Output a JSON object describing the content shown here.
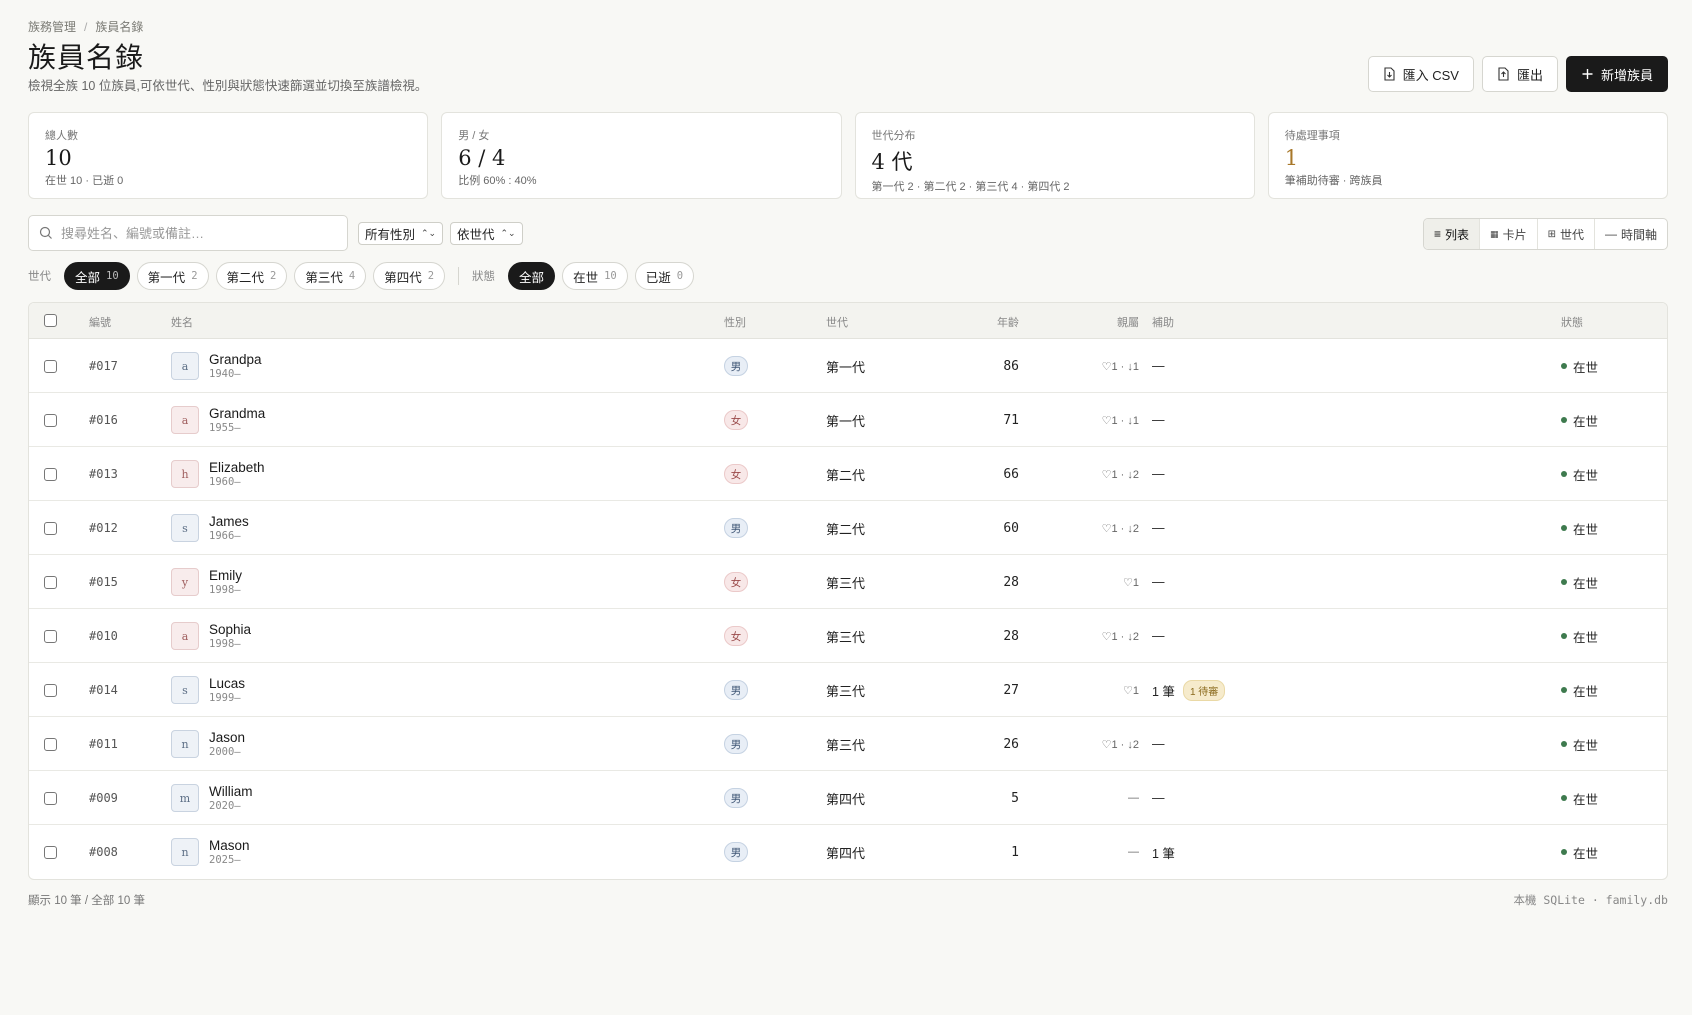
{
  "breadcrumb": {
    "parent": "族務管理",
    "sep": "/",
    "current": "族員名錄"
  },
  "title": "族員名錄",
  "description": "檢視全族 10 位族員,可依世代、性別與狀態快速篩選並切換至族譜檢視。",
  "actions": {
    "import": "匯入 CSV",
    "export": "匯出",
    "add": "新增族員"
  },
  "stats": [
    {
      "label": "總人數",
      "value": "10",
      "sub": "在世 10 · 已逝 0"
    },
    {
      "label": "男 / 女",
      "value": "6 / 4",
      "sub": "比例 60% : 40%"
    },
    {
      "label": "世代分布",
      "value": "4 代",
      "sub": "第一代 2 · 第二代 2 · 第三代 4 · 第四代 2"
    },
    {
      "label": "待處理事項",
      "value": "1",
      "sub": "筆補助待審 · 跨族員"
    }
  ],
  "search": {
    "placeholder": "搜尋姓名、編號或備註…"
  },
  "filters": {
    "gender": "所有性別",
    "sort": "依世代"
  },
  "views": {
    "list": "列表",
    "card": "卡片",
    "gen": "世代",
    "timeline": "時間軸"
  },
  "chips": {
    "gen_label": "世代",
    "gen": [
      {
        "label": "全部",
        "count": "10"
      },
      {
        "label": "第一代",
        "count": "2"
      },
      {
        "label": "第二代",
        "count": "2"
      },
      {
        "label": "第三代",
        "count": "4"
      },
      {
        "label": "第四代",
        "count": "2"
      }
    ],
    "status_label": "狀態",
    "status": [
      {
        "label": "全部",
        "count": ""
      },
      {
        "label": "在世",
        "count": "10"
      },
      {
        "label": "已逝",
        "count": "0"
      }
    ]
  },
  "columns": {
    "id": "編號",
    "name": "姓名",
    "gender": "性別",
    "gen": "世代",
    "age": "年齡",
    "rel": "親屬",
    "aid": "補助",
    "status": "狀態"
  },
  "rows": [
    {
      "id": "#017",
      "initial": "a",
      "name": "Grandpa",
      "years": "1940–",
      "gender": "男",
      "gen": "第一代",
      "age": "86",
      "rel": "♡1 · ↓1",
      "aid": "—",
      "pending": "",
      "status": "在世"
    },
    {
      "id": "#016",
      "initial": "a",
      "name": "Grandma",
      "years": "1955–",
      "gender": "女",
      "gen": "第一代",
      "age": "71",
      "rel": "♡1 · ↓1",
      "aid": "—",
      "pending": "",
      "status": "在世"
    },
    {
      "id": "#013",
      "initial": "h",
      "name": "Elizabeth",
      "years": "1960–",
      "gender": "女",
      "gen": "第二代",
      "age": "66",
      "rel": "♡1 · ↓2",
      "aid": "—",
      "pending": "",
      "status": "在世"
    },
    {
      "id": "#012",
      "initial": "s",
      "name": "James",
      "years": "1966–",
      "gender": "男",
      "gen": "第二代",
      "age": "60",
      "rel": "♡1 · ↓2",
      "aid": "—",
      "pending": "",
      "status": "在世"
    },
    {
      "id": "#015",
      "initial": "y",
      "name": "Emily",
      "years": "1998–",
      "gender": "女",
      "gen": "第三代",
      "age": "28",
      "rel": "♡1",
      "aid": "—",
      "pending": "",
      "status": "在世"
    },
    {
      "id": "#010",
      "initial": "a",
      "name": "Sophia",
      "years": "1998–",
      "gender": "女",
      "gen": "第三代",
      "age": "28",
      "rel": "♡1 · ↓2",
      "aid": "—",
      "pending": "",
      "status": "在世"
    },
    {
      "id": "#014",
      "initial": "s",
      "name": "Lucas",
      "years": "1999–",
      "gender": "男",
      "gen": "第三代",
      "age": "27",
      "rel": "♡1",
      "aid": "1 筆",
      "pending": "1 待審",
      "status": "在世"
    },
    {
      "id": "#011",
      "initial": "n",
      "name": "Jason",
      "years": "2000–",
      "gender": "男",
      "gen": "第三代",
      "age": "26",
      "rel": "♡1 · ↓2",
      "aid": "—",
      "pending": "",
      "status": "在世"
    },
    {
      "id": "#009",
      "initial": "m",
      "name": "William",
      "years": "2020–",
      "gender": "男",
      "gen": "第四代",
      "age": "5",
      "rel": "—",
      "aid": "—",
      "pending": "",
      "status": "在世"
    },
    {
      "id": "#008",
      "initial": "n",
      "name": "Mason",
      "years": "2025–",
      "gender": "男",
      "gen": "第四代",
      "age": "1",
      "rel": "—",
      "aid": "1 筆",
      "pending": "",
      "status": "在世"
    }
  ],
  "footer": {
    "count": "顯示 10 筆 / 全部 10 筆",
    "source": "本機 SQLite · family.db"
  },
  "colors": {
    "primary": "#1a1a1a",
    "male": "#e8eef6",
    "female": "#f8e8e8",
    "alive": "#3e7a4e",
    "pending": "#f6ebcc"
  }
}
